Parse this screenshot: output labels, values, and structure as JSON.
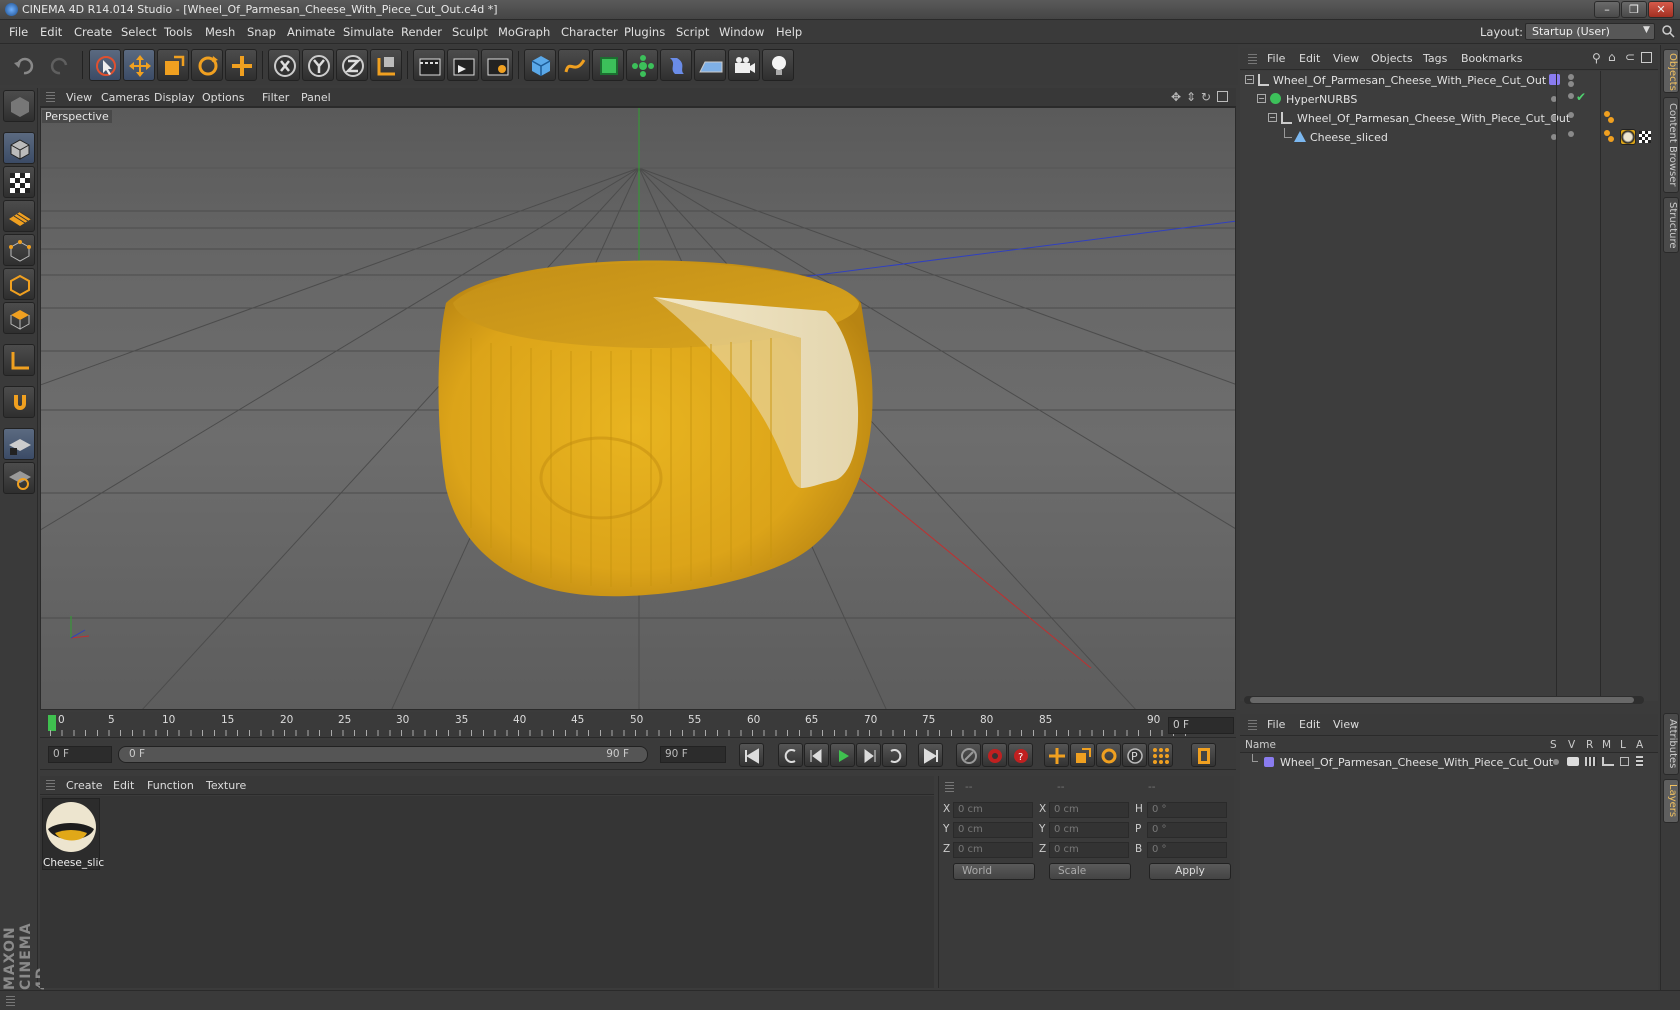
{
  "window": {
    "title": "CINEMA 4D R14.014 Studio - [Wheel_Of_Parmesan_Cheese_With_Piece_Cut_Out.c4d *]",
    "controls": [
      "–",
      "❐",
      "✕"
    ]
  },
  "menubar": {
    "items": [
      "File",
      "Edit",
      "Create",
      "Select",
      "Tools",
      "Mesh",
      "Snap",
      "Animate",
      "Simulate",
      "Render",
      "Sculpt",
      "MoGraph",
      "Character",
      "Plugins",
      "Script",
      "Window",
      "Help"
    ],
    "layout_label": "Layout:",
    "layout_value": "Startup (User)"
  },
  "viewport": {
    "menu": [
      "View",
      "Cameras",
      "Display",
      "Options",
      "Filter",
      "Panel"
    ],
    "label": "Perspective"
  },
  "timeline": {
    "ticks": [
      "0",
      "5",
      "10",
      "15",
      "20",
      "25",
      "30",
      "35",
      "40",
      "45",
      "50",
      "55",
      "60",
      "65",
      "70",
      "75",
      "80",
      "85",
      "90"
    ],
    "current_frame": "0 F"
  },
  "transport": {
    "start_field": "0 F",
    "range_start": "0 F",
    "range_end": "90 F",
    "end_field": "90 F"
  },
  "material_manager": {
    "menu": [
      "Create",
      "Edit",
      "Function",
      "Texture"
    ],
    "materials": [
      {
        "name": "Cheese_slic"
      }
    ]
  },
  "coordinates": {
    "headers": [
      "--",
      "--",
      "--"
    ],
    "rows": [
      {
        "a_label": "X",
        "a_val": "0 cm",
        "b_label": "X",
        "b_val": "0 cm",
        "c_label": "H",
        "c_val": "0 °"
      },
      {
        "a_label": "Y",
        "a_val": "0 cm",
        "b_label": "Y",
        "b_val": "0 cm",
        "c_label": "P",
        "c_val": "0 °"
      },
      {
        "a_label": "Z",
        "a_val": "0 cm",
        "b_label": "Z",
        "b_val": "0 cm",
        "c_label": "B",
        "c_val": "0 °"
      }
    ],
    "space": "World",
    "mode": "Scale",
    "apply": "Apply"
  },
  "objects": {
    "menu": [
      "File",
      "Edit",
      "View",
      "Objects",
      "Tags",
      "Bookmarks"
    ],
    "tree": [
      {
        "name": "Wheel_Of_Parmesan_Cheese_With_Piece_Cut_Out",
        "icon": "null-icon",
        "level": 0
      },
      {
        "name": "HyperNURBS",
        "icon": "hypernurbs-icon",
        "level": 1
      },
      {
        "name": "Wheel_Of_Parmesan_Cheese_With_Piece_Cut_Out",
        "icon": "null-icon",
        "level": 2
      },
      {
        "name": "Cheese_sliced",
        "icon": "polygon-icon",
        "level": 3
      }
    ]
  },
  "layers": {
    "menu": [
      "File",
      "Edit",
      "View"
    ],
    "headers": {
      "name": "Name",
      "cols": [
        "S",
        "V",
        "R",
        "M",
        "L",
        "A"
      ]
    },
    "rows": [
      {
        "name": "Wheel_Of_Parmesan_Cheese_With_Piece_Cut_Out",
        "color": "#8a7cf0"
      }
    ]
  },
  "right_tabs": [
    "Objects",
    "Content Browser",
    "Structure",
    "Attributes",
    "Layers"
  ],
  "brand": "MAXON CINEMA 4D",
  "colors": {
    "accent": "#f0a020",
    "selection": "#5b6a80",
    "x_axis": "#c03030",
    "y_axis": "#30a030",
    "z_axis": "#3040c0"
  }
}
